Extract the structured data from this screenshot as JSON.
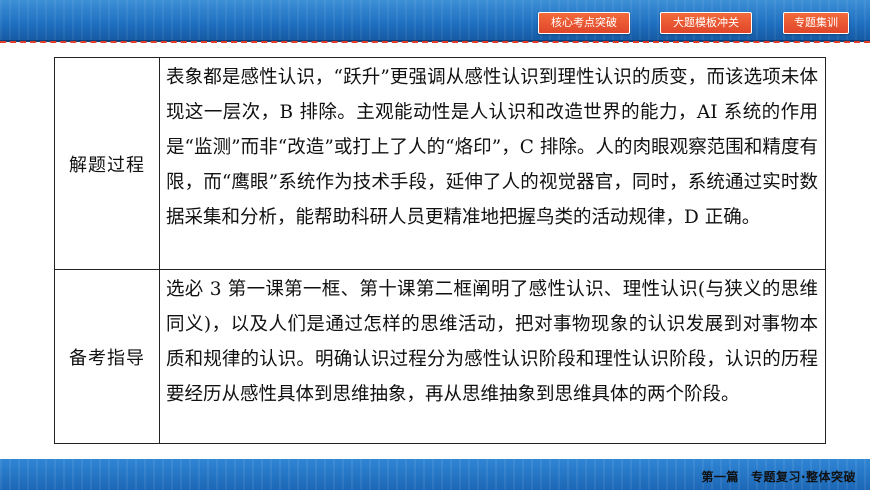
{
  "nav": {
    "buttons": [
      "核心考点突破",
      "大题模板冲关",
      "专题集训"
    ]
  },
  "table": {
    "rows": [
      {
        "label": "解题过程",
        "text": "表象都是感性认识，“跃升”更强调从感性认识到理性认识的质变，而该选项未体现这一层次，B 排除。主观能动性是人认识和改造世界的能力，AI 系统的作用是“监测”而非“改造”或打上了人的“烙印”，C 排除。人的肉眼观察范围和精度有限，而“鹰眼”系统作为技术手段，延伸了人的视觉器官，同时，系统通过实时数据采集和分析，能帮助科研人员更精准地把握鸟类的活动规律，D 正确。"
      },
      {
        "label": "备考指导",
        "text": "选必 3 第一课第一框、第十课第二框阐明了感性认识、理性认识(与狭义的思维同义)，以及人们是通过怎样的思维活动，把对事物现象的认识发展到对事物本质和规律的认识。明确认识过程分为感性认识阶段和理性认识阶段，认识的历程要经历从感性具体到思维抽象，再从思维抽象到思维具体的两个阶段。"
      }
    ]
  },
  "footer": {
    "part": "第一篇",
    "title": "专题复习·整体突破"
  },
  "colors": {
    "banner_blue": "#1f6fc0",
    "button_orange": "#e0452a",
    "dash_red": "#e23b2a"
  }
}
